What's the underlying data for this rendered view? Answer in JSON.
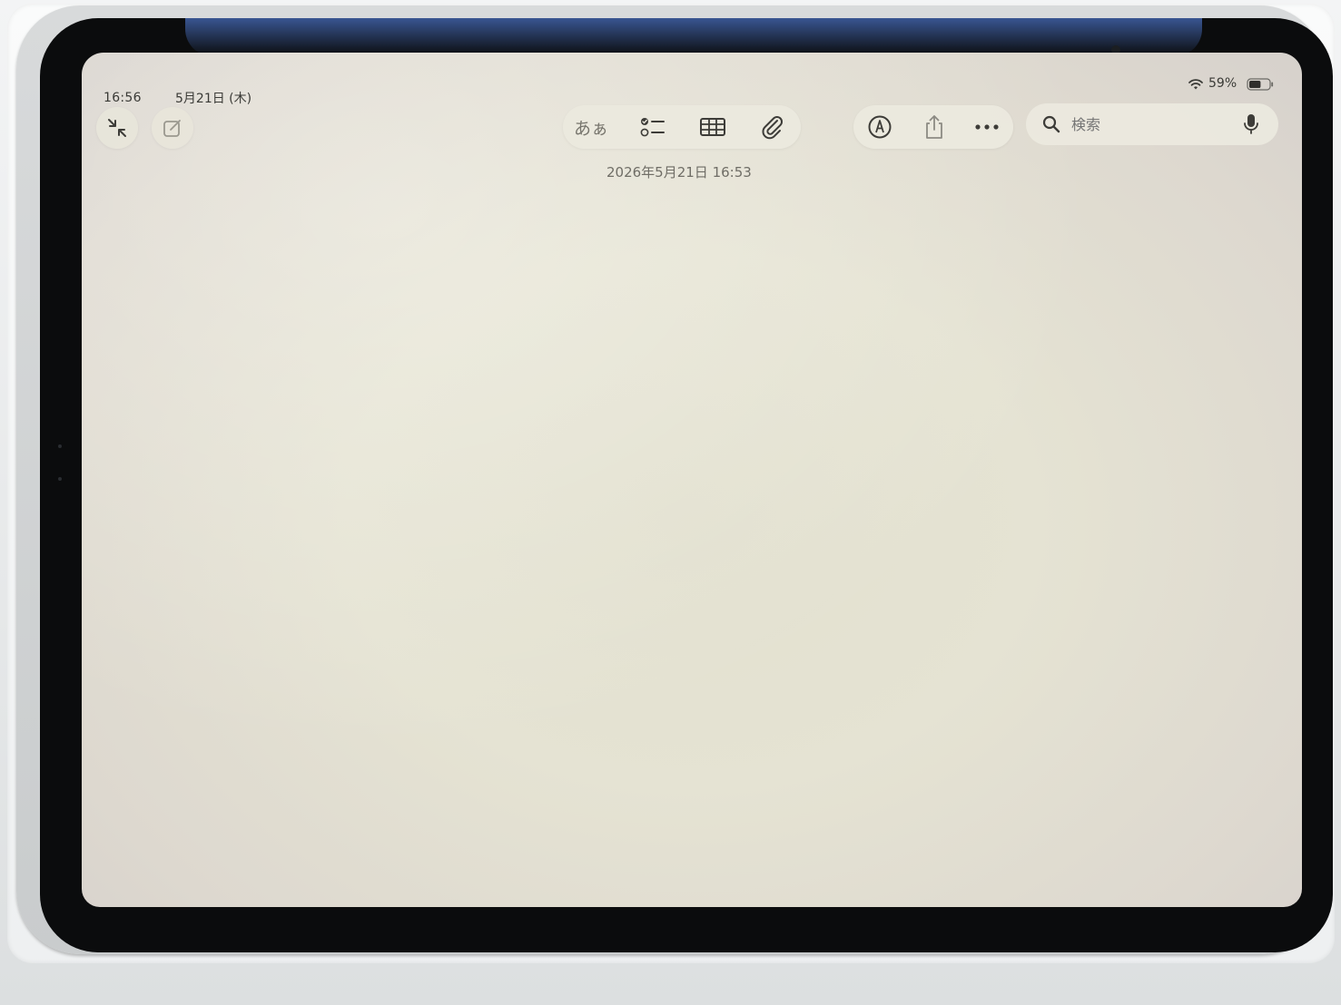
{
  "status_bar": {
    "time": "16:56",
    "date": "5月21日 (木)",
    "battery_percent": "59%",
    "battery_level": 0.59,
    "wifi_icon": "wifi-icon",
    "battery_icon": "battery-icon"
  },
  "toolbar": {
    "left_buttons": [
      {
        "name": "minimize-arrows-icon"
      },
      {
        "name": "compose-icon"
      }
    ],
    "format_label": "あぁ",
    "format_group_icons": [
      "text-format",
      "checklist-icon",
      "table-icon",
      "paperclip-icon"
    ],
    "action_group_icons": [
      "markup-pen-icon",
      "share-icon",
      "more-icon"
    ]
  },
  "search": {
    "placeholder": "検索"
  },
  "note": {
    "timestamp": "2026年5月21日 16:53",
    "body": ""
  },
  "colors": {
    "screen_background": "#e3e1d1",
    "icon": "#3d3c38",
    "bezel": "#0b0c0d"
  }
}
